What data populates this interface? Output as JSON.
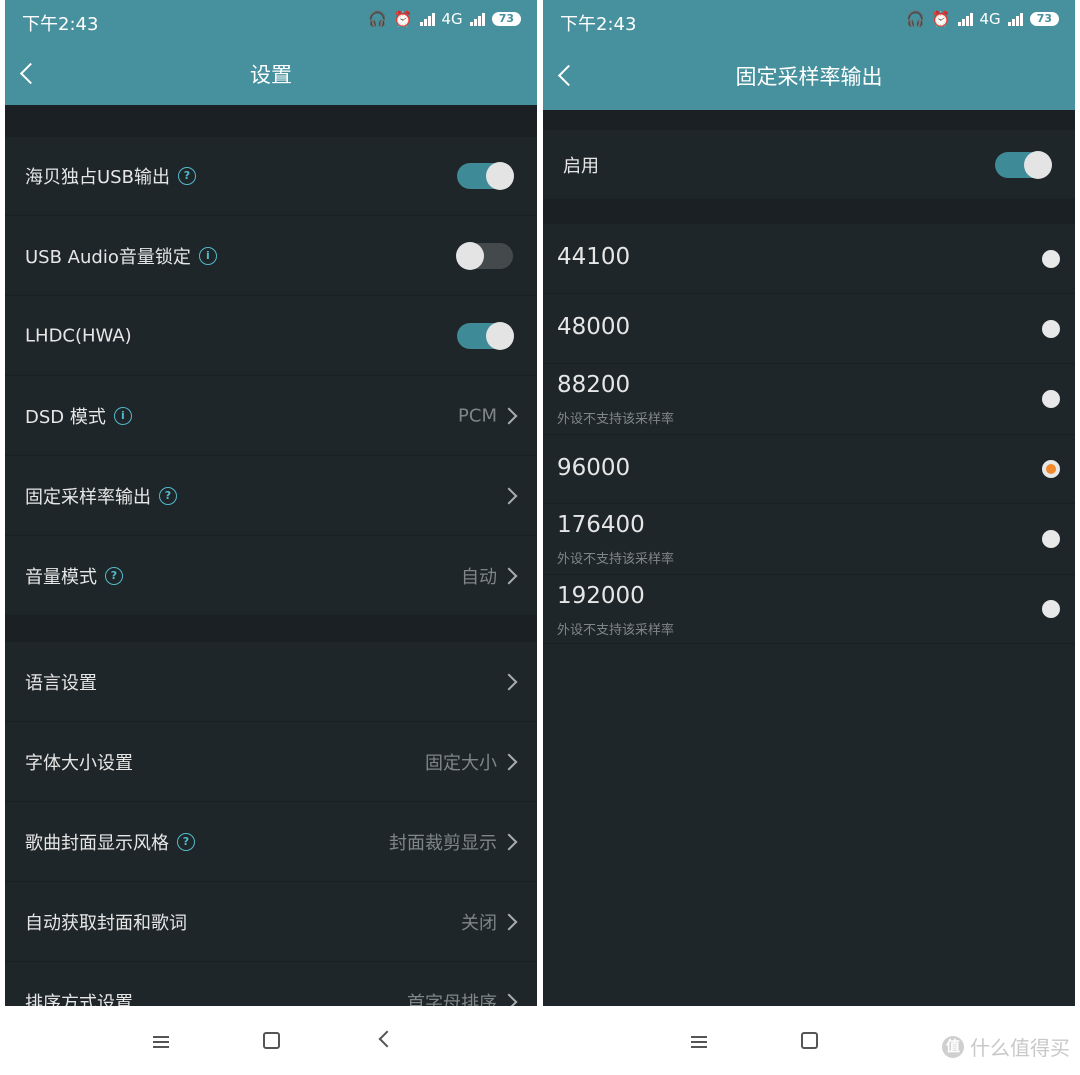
{
  "status_bar": {
    "time": "下午2:43",
    "network": "4G",
    "battery": "73"
  },
  "left": {
    "title": "设置",
    "rows": [
      {
        "label": "海贝独占USB输出",
        "help": "?",
        "toggle": true
      },
      {
        "label": "USB Audio音量锁定",
        "help": "i",
        "toggle": false
      },
      {
        "label": "LHDC(HWA)",
        "toggle": true
      },
      {
        "label": "DSD 模式",
        "help": "i",
        "value": "PCM"
      },
      {
        "label": "固定采样率输出",
        "help": "?",
        "value": ""
      },
      {
        "label": "音量模式",
        "help": "?",
        "value": "自动"
      },
      {
        "label": "语言设置",
        "value": ""
      },
      {
        "label": "字体大小设置",
        "value": "固定大小"
      },
      {
        "label": "歌曲封面显示风格",
        "help": "?",
        "value": "封面裁剪显示"
      },
      {
        "label": "自动获取封面和歌词",
        "value": "关闭"
      },
      {
        "label": "排序方式设置",
        "value": "首字母排序"
      }
    ]
  },
  "right": {
    "title": "固定采样率输出",
    "enable_label": "启用",
    "enable_on": true,
    "rates": [
      {
        "value": "44100",
        "note": ""
      },
      {
        "value": "48000",
        "note": ""
      },
      {
        "value": "88200",
        "note": "外设不支持该采样率"
      },
      {
        "value": "96000",
        "note": "",
        "selected": true
      },
      {
        "value": "176400",
        "note": "外设不支持该采样率"
      },
      {
        "value": "192000",
        "note": "外设不支持该采样率"
      }
    ]
  },
  "watermark": {
    "text": "什么值得买",
    "badge": "值"
  },
  "colors": {
    "accent": "#46919d",
    "background": "#1f2629",
    "radio_selected": "#f08a2c"
  },
  "icons": [
    "back-chevron-icon",
    "help-icon",
    "info-icon",
    "chevron-right-icon",
    "menu-icon",
    "home-icon",
    "back-icon",
    "headphones-icon",
    "alarm-icon",
    "signal-icon",
    "battery-icon"
  ]
}
